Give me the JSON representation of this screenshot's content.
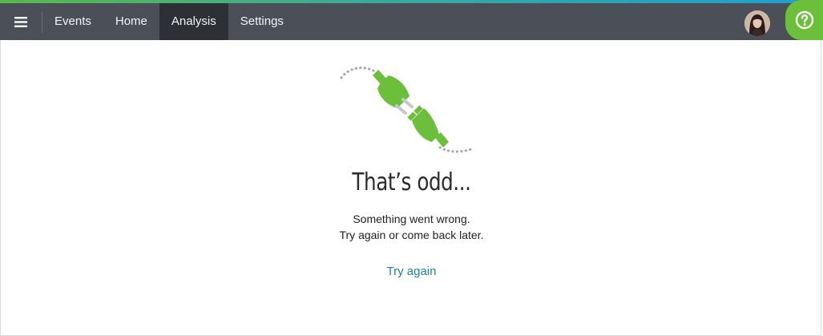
{
  "nav": {
    "items": [
      {
        "label": "Events",
        "active": false
      },
      {
        "label": "Home",
        "active": false
      },
      {
        "label": "Analysis",
        "active": true
      },
      {
        "label": "Settings",
        "active": false
      }
    ]
  },
  "icons": {
    "menu": "hamburger-menu-icon",
    "avatar": "user-avatar",
    "help": "help-question-icon",
    "illustration": "unplugged-plug-icon"
  },
  "error": {
    "headline": "That’s odd...",
    "message_line1": "Something went wrong.",
    "message_line2": "Try again or come back later.",
    "retry_label": "Try again"
  },
  "colors": {
    "topbar": "#4b4f57",
    "active_tab": "#2d3035",
    "brand_green": "#6bbf3b",
    "link": "#1f7ea6"
  }
}
